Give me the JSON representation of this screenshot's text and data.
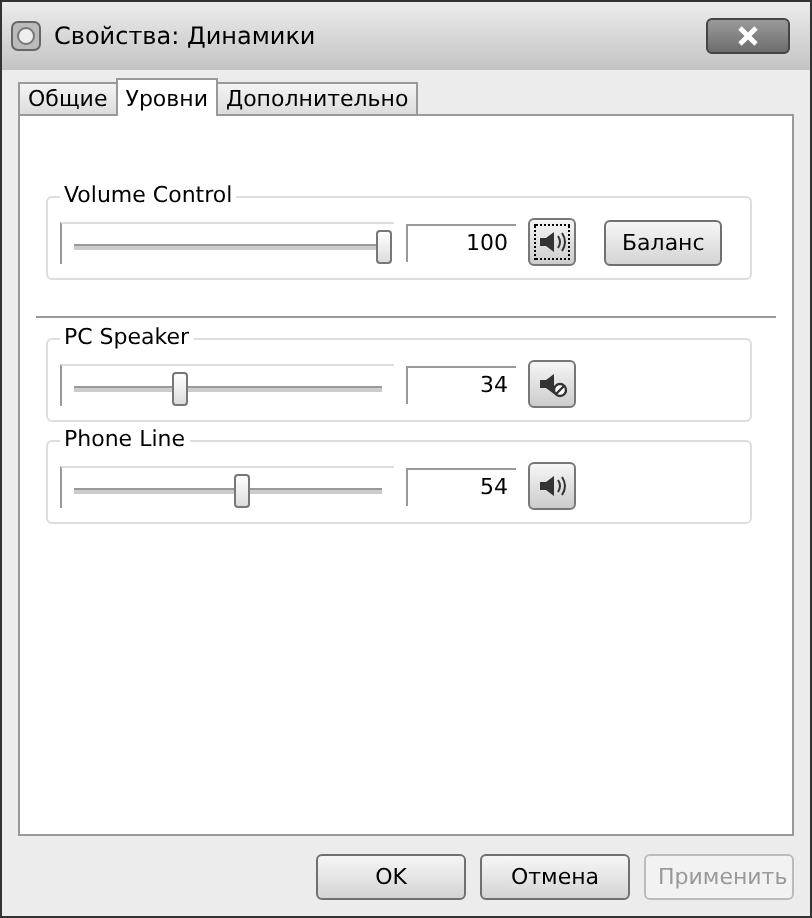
{
  "window": {
    "title": "Свойства: Динамики"
  },
  "tabs": [
    {
      "label": "Общие",
      "selected": false
    },
    {
      "label": "Уровни",
      "selected": true
    },
    {
      "label": "Дополнительно",
      "selected": false
    }
  ],
  "master": {
    "name": "Volume Control",
    "level": 1.0,
    "reading": "100",
    "muted": false,
    "balance_button": "Баланс"
  },
  "channels": [
    {
      "name": "PC Speaker",
      "level": 0.34,
      "reading": "34",
      "muted": true
    },
    {
      "name": "Phone Line",
      "level": 0.54,
      "reading": "54",
      "muted": false
    }
  ],
  "buttons": [
    {
      "label": "OK",
      "disabled": false
    },
    {
      "label": "Отмена",
      "disabled": false
    },
    {
      "label": "Применить",
      "disabled": true
    }
  ]
}
